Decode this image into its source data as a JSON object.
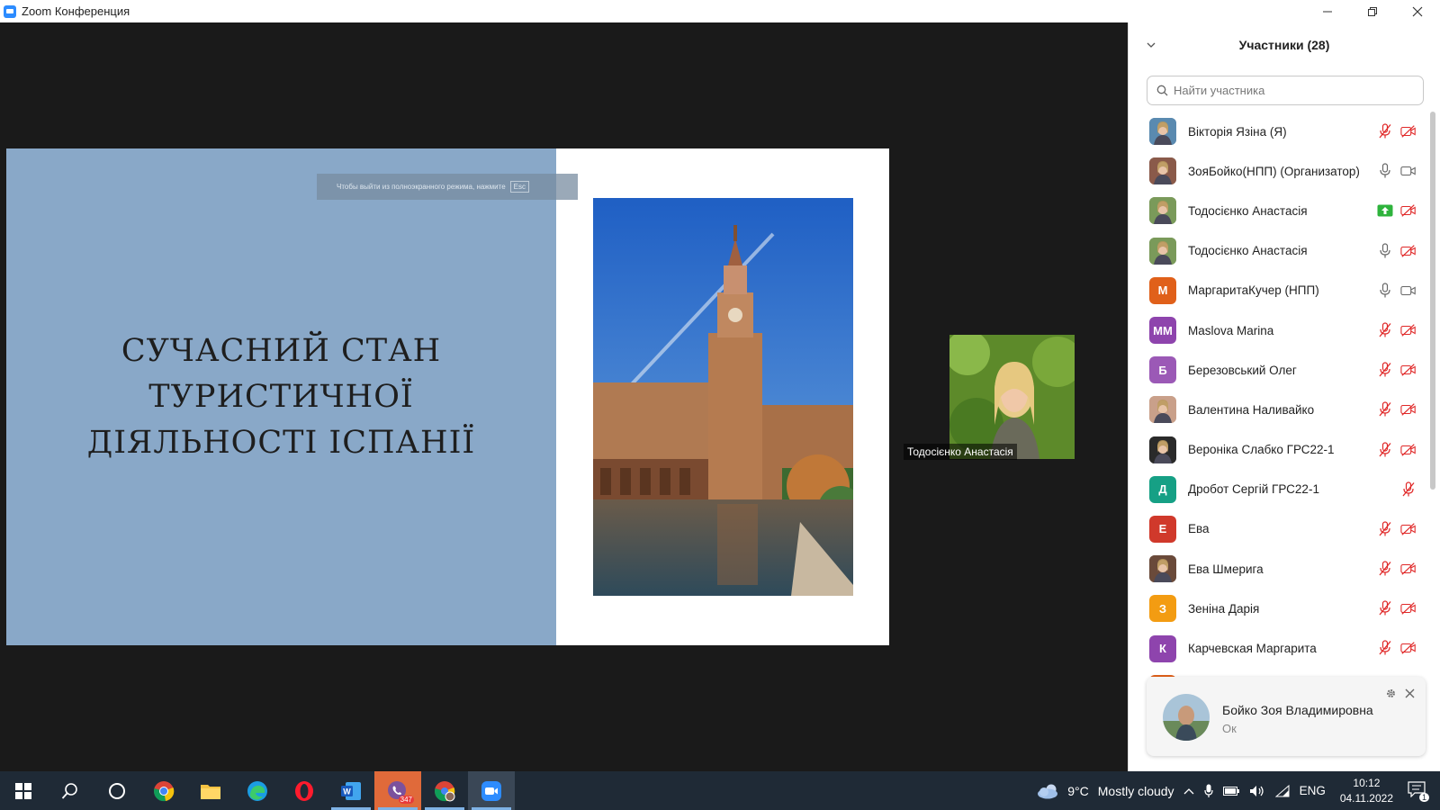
{
  "window": {
    "title": "Zoom Конференция"
  },
  "slide": {
    "title_lines": [
      "СУЧАСНИЙ СТАН",
      "ТУРИСТИЧНОЇ",
      "ДІЯЛЬНОСТІ ІСПАНІЇ"
    ],
    "fullscreen_hint": "Чтобы выйти из полноэкранного режима, нажмите",
    "fullscreen_key": "Esc"
  },
  "video": {
    "name": "Тодосієнко Анастасія"
  },
  "panel": {
    "title": "Участники (28)",
    "search_placeholder": "Найти участника",
    "participants": [
      {
        "name": "Вікторія Язіна (Я)",
        "avatar": "photo",
        "color": "#5a8ab0",
        "mic": "muted",
        "cam": "off"
      },
      {
        "name": "ЗояБойко(НПП) (Организатор)",
        "avatar": "photo",
        "color": "#8a5a4a",
        "mic": "on",
        "cam": "on"
      },
      {
        "name": "Тодосієнко Анастасія",
        "avatar": "photo",
        "color": "#7a9a5a",
        "mic": "share",
        "cam": "off"
      },
      {
        "name": "Тодосієнко Анастасія",
        "avatar": "photo",
        "color": "#7a9a5a",
        "mic": "on",
        "cam": "off"
      },
      {
        "name": "МаргаритаКучер  (НПП)",
        "avatar": "М",
        "color": "#e0601a",
        "mic": "on",
        "cam": "on"
      },
      {
        "name": "Maslova Marina",
        "avatar": "MM",
        "color": "#8e44ad",
        "mic": "muted",
        "cam": "off"
      },
      {
        "name": "Березовський Олег",
        "avatar": "Б",
        "color": "#9b59b6",
        "mic": "muted",
        "cam": "off"
      },
      {
        "name": "Валентина Наливайко",
        "avatar": "photo",
        "color": "#c9a08a",
        "mic": "muted",
        "cam": "off"
      },
      {
        "name": "Вероніка Слабко ГРС22-1",
        "avatar": "photo",
        "color": "#2a2a2a",
        "mic": "muted",
        "cam": "off"
      },
      {
        "name": "Дробот Сергій ГРС22-1",
        "avatar": "Д",
        "color": "#16a085",
        "mic": "none",
        "cam": "muted"
      },
      {
        "name": "Ева",
        "avatar": "Е",
        "color": "#d0392b",
        "mic": "muted",
        "cam": "off"
      },
      {
        "name": "Ева Шмерига",
        "avatar": "photo",
        "color": "#6a4a3a",
        "mic": "muted",
        "cam": "off"
      },
      {
        "name": "Зеніна Дарія",
        "avatar": "З",
        "color": "#f39c12",
        "mic": "muted",
        "cam": "off"
      },
      {
        "name": "Карчевская Маргарита",
        "avatar": "К",
        "color": "#8e44ad",
        "mic": "muted",
        "cam": "off"
      },
      {
        "name": "",
        "avatar": "",
        "color": "#e0601a",
        "mic": "none",
        "cam": "none"
      }
    ]
  },
  "notification": {
    "name": "Бойко Зоя Владимировна",
    "message": "Ок"
  },
  "taskbar": {
    "badge": "347",
    "weather_temp": "9°C",
    "weather_text": "Mostly cloudy",
    "lang": "ENG",
    "time": "10:12",
    "date": "04.11.2022",
    "notif_count": "1"
  },
  "colors": {
    "accent_red": "#e02828",
    "share_green": "#2eb33c",
    "slide_blue": "#89a8c8"
  }
}
